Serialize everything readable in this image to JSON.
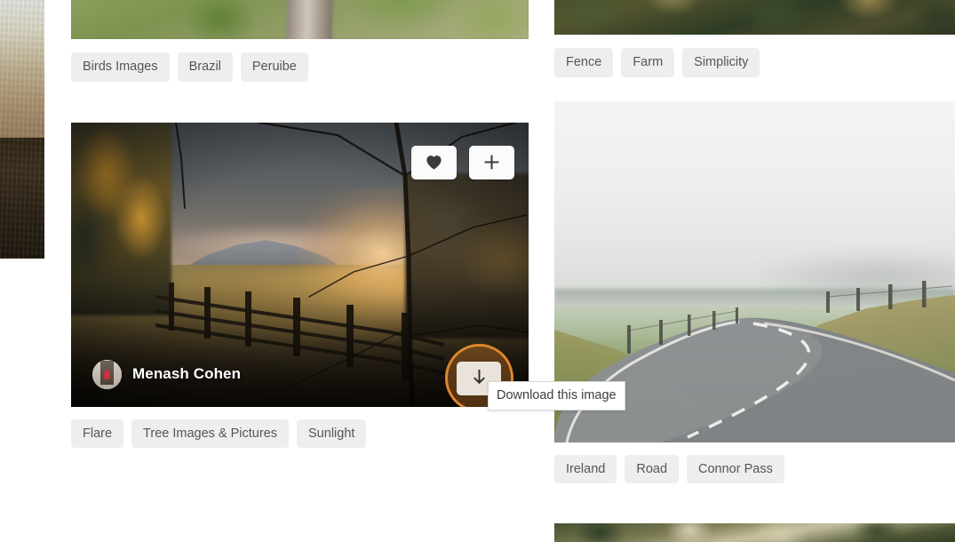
{
  "tooltip": {
    "text": "Download this image"
  },
  "left_column": {
    "cards": [
      {
        "photo_name": "photo-birds-brazil-peruibe",
        "photo_alt": "Blurred green foliage with a pale tree trunk",
        "tags": [
          "Birds Images",
          "Brazil",
          "Peruibe"
        ]
      },
      {
        "photo_name": "photo-flare-tree-sunlight",
        "photo_alt": "Golden hour sunlight over a wooden fence and autumn field",
        "author": "Menash Cohen",
        "tags": [
          "Flare",
          "Tree Images & Pictures",
          "Sunlight"
        ],
        "actions": {
          "like": "like-button",
          "add": "add-to-collection-button",
          "download": "download-button"
        }
      }
    ]
  },
  "right_column": {
    "cards": [
      {
        "photo_name": "photo-fence-farm-simplicity",
        "photo_alt": "Dark green tall grass close-up",
        "tags": [
          "Fence",
          "Farm",
          "Simplicity"
        ]
      },
      {
        "photo_name": "photo-ireland-road-connor-pass",
        "photo_alt": "Empty curving road through misty Irish hills",
        "tags": [
          "Ireland",
          "Road",
          "Connor Pass"
        ]
      },
      {
        "photo_name": "photo-bottom-partial",
        "photo_alt": "Partially visible sunlit grass photo",
        "tags": []
      }
    ]
  },
  "edge_photo": {
    "photo_name": "photo-left-edge-partial",
    "photo_alt": "Partially visible hazy landscape clipped at the left edge"
  },
  "colors": {
    "tag_background": "#eeeeee",
    "tag_text": "#555555",
    "cursor_highlight": "#e0862b",
    "page_background": "#ffffff",
    "tooltip_background": "#ffffff",
    "author_text": "#ffffff"
  },
  "icons": {
    "heart": "heart-icon",
    "plus": "plus-icon",
    "download_arrow": "download-arrow-icon"
  }
}
